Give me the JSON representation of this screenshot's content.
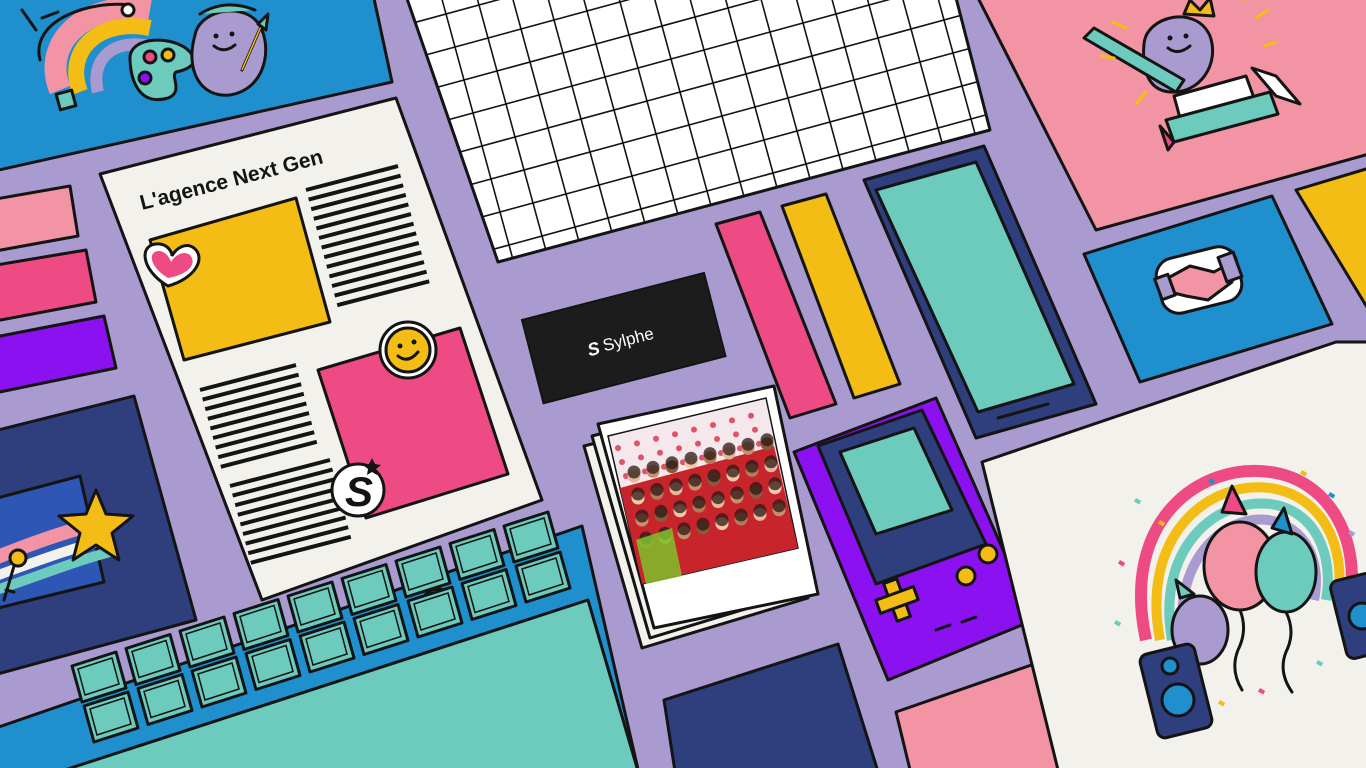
{
  "flyer": {
    "title": "L'agence Next Gen"
  },
  "business_card": {
    "brand": "Sylphe",
    "logo_letter": "S"
  },
  "sticker": {
    "letter": "S"
  },
  "colors": {
    "background": "#a99bd0",
    "ink": "#141414",
    "blue": "#1f8fce",
    "navy": "#2f3e7c",
    "pink": "#ee4a84",
    "light_pink": "#f294a3",
    "yellow": "#f3bd16",
    "teal": "#6dcbbd",
    "purple": "#8b11f0",
    "paper": "#f3f1ec",
    "card_black": "#1c1c1c"
  },
  "icons": [
    "heart-icon",
    "smiley-icon",
    "star-icon",
    "key-icon",
    "handshake-icon",
    "ruler-icon",
    "crown-icon",
    "books-icon",
    "palette-icon",
    "paintbrush-icon",
    "dpad-icon",
    "rainbow-icon",
    "balloon-icon",
    "speaker-icon"
  ]
}
